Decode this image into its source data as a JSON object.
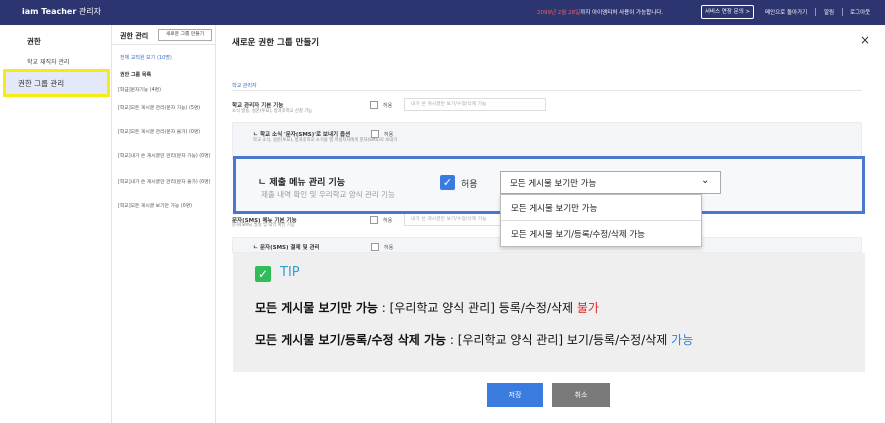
{
  "header": {
    "logo": "iam Teacher",
    "logo_suffix": "관리자",
    "notice_pre": "2099년 2월 28일",
    "notice_post": "까지 아이엠티처 사용이 가능합니다.",
    "service_button": "서비스 연장 문의 >",
    "links": [
      "메인으로 돌아가기",
      "알림",
      "로그아웃"
    ]
  },
  "sidebar": {
    "title": "권한",
    "items": [
      {
        "label": "학교 재직자 관리"
      },
      {
        "label": "권한 그룹 관리",
        "active": true
      }
    ]
  },
  "group_panel": {
    "title": "권한 관리",
    "new_button": "새로운 그룹 만들기",
    "all_link": "전체 교직원 보기 (10명)",
    "list_title": "권한 그룹 목록",
    "items": [
      "[학급]문자기능 (4명)",
      "[학교]모든 게시글 관리(문자 가능) (5명)",
      "[학교]모든 게시글 관리(문자 불가) (0명)",
      "[학교]내가 쓴 게시글만 관리(문자 가능) (0명)",
      "[학교]내가 쓴 게시글만 관리(문자 불가) (0명)",
      "[학교]모든 게시글 보기만 가능 (0명)"
    ]
  },
  "main": {
    "title": "새로운 권한 그룹 만들기",
    "close_icon": "×",
    "section_label": "학교 관리자",
    "rows": [
      {
        "title": "학교 관리자 기본 기능",
        "desc": "소식 발송, 설문(투표), 방과후학교 신청 기능",
        "allow": "허용",
        "select": "내가 쓴 게시글만 보기/수정/삭제 가능"
      },
      {
        "title": "ㄴ 학교 소식 '문자(SMS)'로 보내기 옵션",
        "desc": "학교 소식, 설문(투표), 방과후학교 소식을 앱 미설치자에게 문자(SMS)로 보내기",
        "allow": "허용"
      },
      {
        "title": "문자(SMS) 메뉴 기본 기능",
        "desc": "문자(SMS) 발송 및 내역 확인 기능",
        "allow": "허용",
        "select": "내가 쓴 게시글만 보기/수정/삭제 가능"
      },
      {
        "title": "ㄴ 문자(SMS) 결제 및 관리",
        "allow": "허용"
      }
    ],
    "highlight": {
      "title": "ㄴ 제출 메뉴 관리 기능",
      "desc": "제출 내역 확인 및 우리학교 양식 관리 기능",
      "allow": "허용",
      "checked": true,
      "selected": "모든 게시물 보기만 가능",
      "options": [
        "모든 게시물 보기만 가능",
        "모든 게시물 보기/등록/수정/삭제 가능"
      ]
    }
  },
  "tip": {
    "label": "TIP",
    "line1_bold": "모든 게시물 보기만 가능",
    "line1_text": " : [우리학교 양식 관리] 등록/수정/삭제 ",
    "line1_status": "불가",
    "line2_bold": "모든 게시물 보기/등록/수정 삭제 가능",
    "line2_text": " : [우리학교 양식 관리] 보기/등록/수정/삭제 ",
    "line2_status": "가능",
    "status_colors": {
      "불가": "#e02525",
      "가능": "#2a7fd4"
    }
  },
  "footer": {
    "save": "저장",
    "cancel": "취소"
  }
}
